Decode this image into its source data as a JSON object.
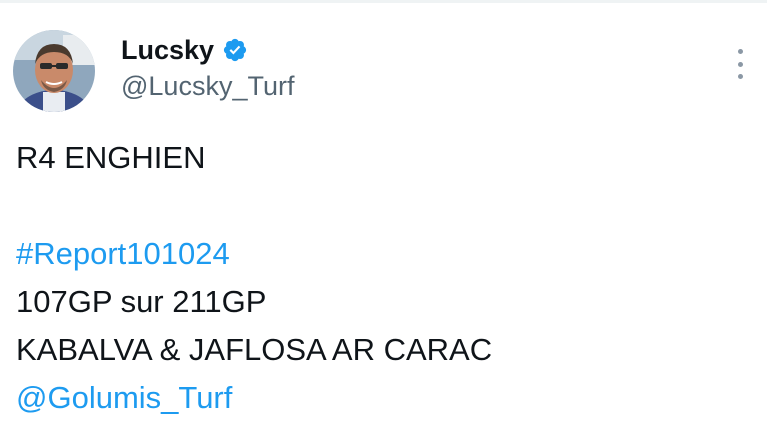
{
  "tweet": {
    "author": {
      "display_name": "Lucsky",
      "handle": "@Lucsky_Turf",
      "verified": true,
      "avatar_icon": "profile-photo"
    },
    "menu_icon": "more-vertical-icon",
    "lines": [
      "R4 ENGHIEN",
      "#Report101024",
      "107GP sur 211GP",
      "KABALVA & JAFLOSA AR CARAC",
      "@Golumis_Turf"
    ]
  },
  "colors": {
    "text": "#0f1419",
    "secondary": "#536471",
    "link": "#1d9bf0",
    "verified_badge": "#1d9bf0"
  }
}
